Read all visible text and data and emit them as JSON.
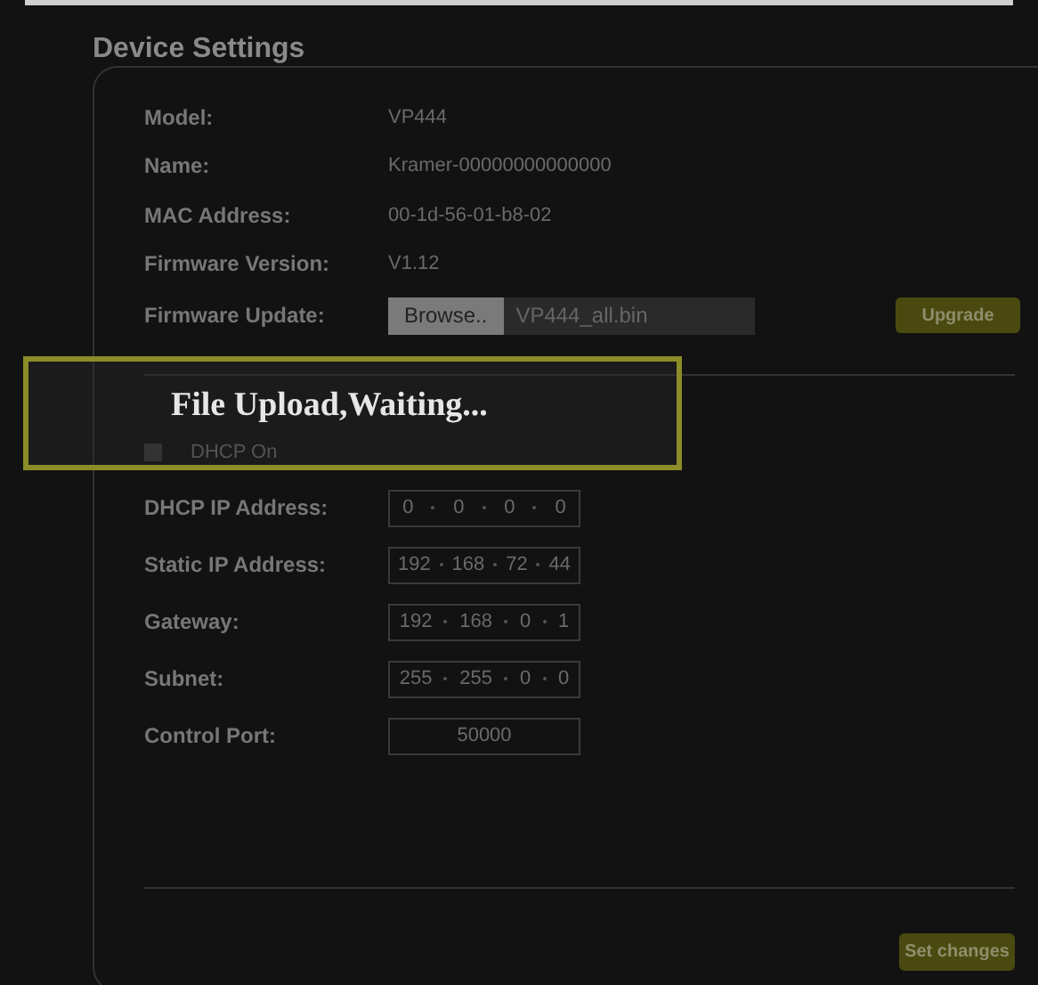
{
  "title": "Device Settings",
  "info": [
    {
      "label": "Model:",
      "value": "VP444"
    },
    {
      "label": "Name:",
      "value": "Kramer-00000000000000"
    },
    {
      "label": "MAC Address:",
      "value": "00-1d-56-01-b8-02"
    },
    {
      "label": "Firmware Version:",
      "value": "V1.12"
    }
  ],
  "firmware_update": {
    "label": "Firmware Update:",
    "browse": "Browse..",
    "file": "VP444_all.bin",
    "upgrade": "Upgrade"
  },
  "dhcp": {
    "label": "DHCP On",
    "checked": false
  },
  "network": [
    {
      "kind": "ip",
      "label": "DHCP IP Address:",
      "octets": [
        "0",
        "0",
        "0",
        "0"
      ]
    },
    {
      "kind": "ip",
      "label": "Static IP Address:",
      "octets": [
        "192",
        "168",
        "72",
        "44"
      ]
    },
    {
      "kind": "ip",
      "label": "Gateway:",
      "octets": [
        "192",
        "168",
        "0",
        "1"
      ]
    },
    {
      "kind": "ip",
      "label": "Subnet:",
      "octets": [
        "255",
        "255",
        "0",
        "0"
      ]
    },
    {
      "kind": "port",
      "label": "Control Port:",
      "value": "50000"
    }
  ],
  "set_changes": "Set changes",
  "dialog": {
    "message": "File Upload,Waiting..."
  }
}
